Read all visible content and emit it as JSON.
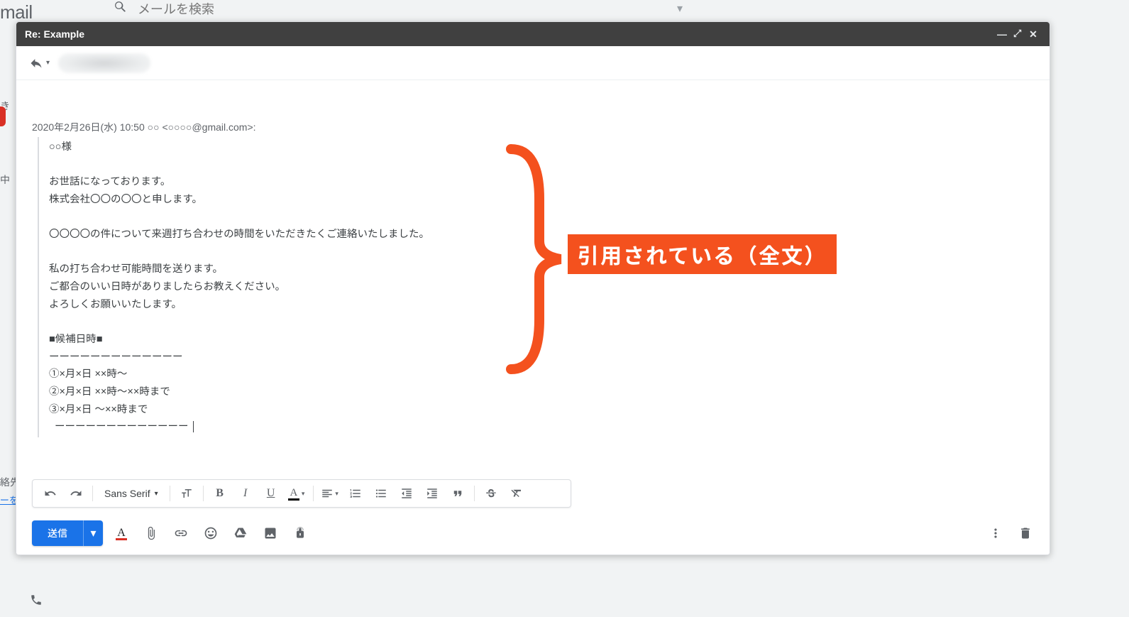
{
  "background": {
    "logo_text": "mail",
    "search_placeholder": "メールを検索",
    "sidebar_fragments": [
      "き",
      "中",
      "絡先",
      "ーを"
    ],
    "phone_glyph": "📞"
  },
  "compose": {
    "title": "Re: Example",
    "window": {
      "min": "—",
      "pop": "⤢",
      "close": "✕"
    },
    "recipients": {
      "reply_glyph": "↩",
      "dropdown_glyph": "▾"
    },
    "body": {
      "attribution": "2020年2月26日(水) 10:50 ○○ <○○○○@gmail.com>:",
      "quoted_lines": [
        "○○様",
        "",
        "お世話になっております。",
        "株式会社〇〇の〇〇と申します。",
        "",
        "〇〇〇〇の件について来週打ち合わせの時間をいただきたくご連絡いたしました。",
        "",
        "私の打ち合わせ可能時間を送ります。",
        "ご都合のいい日時がありましたらお教えください。",
        "よろしくお願いいたします。",
        "",
        "■候補日時■",
        "ーーーーーーーーーーーーー",
        "①×月×日 ××時〜",
        "②×月×日 ××時〜××時まで",
        "③×月×日 〜××時まで",
        "  ーーーーーーーーーーーーー"
      ]
    }
  },
  "annotation": {
    "label": "引用されている（全文）"
  },
  "format_toolbar": {
    "font_name": "Sans Serif",
    "buttons": [
      "undo",
      "redo",
      "font",
      "size",
      "bold",
      "italic",
      "underline",
      "text-color",
      "align",
      "numbered-list",
      "bulleted-list",
      "indent-less",
      "indent-more",
      "quote",
      "strikethrough",
      "clear-format"
    ]
  },
  "send_bar": {
    "send_label": "送信",
    "icons": [
      "text-color",
      "attach",
      "link",
      "emoji",
      "drive",
      "image",
      "confidential"
    ],
    "right_icons": [
      "more",
      "discard"
    ]
  }
}
